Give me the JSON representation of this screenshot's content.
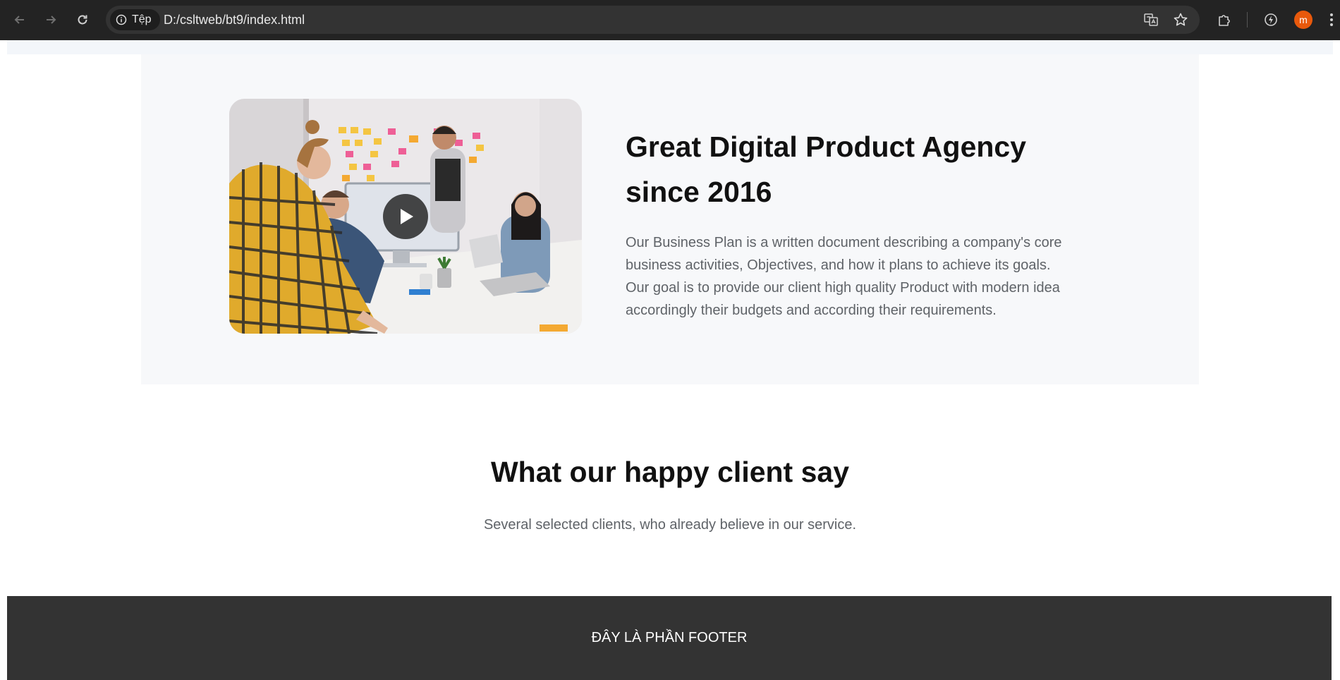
{
  "browser": {
    "site_info_label": "Tệp",
    "url": "D:/csltweb/bt9/index.html",
    "profile_initial": "m",
    "profile_color": "#e8590c"
  },
  "about": {
    "title": "Great Digital Product Agency since 2016",
    "description": "Our Business Plan is a written document describing a company's core business activities, Objectives, and how it plans to achieve its goals. Our goal is to provide our client high quality Product with modern idea accordingly their budgets and according their requirements.",
    "media_icon": "play-icon"
  },
  "testimonials": {
    "title": "What our happy client say",
    "subtitle": "Several selected clients, who already believe in our service."
  },
  "footer": {
    "text": "ĐÂY LÀ PHẦN FOOTER"
  }
}
